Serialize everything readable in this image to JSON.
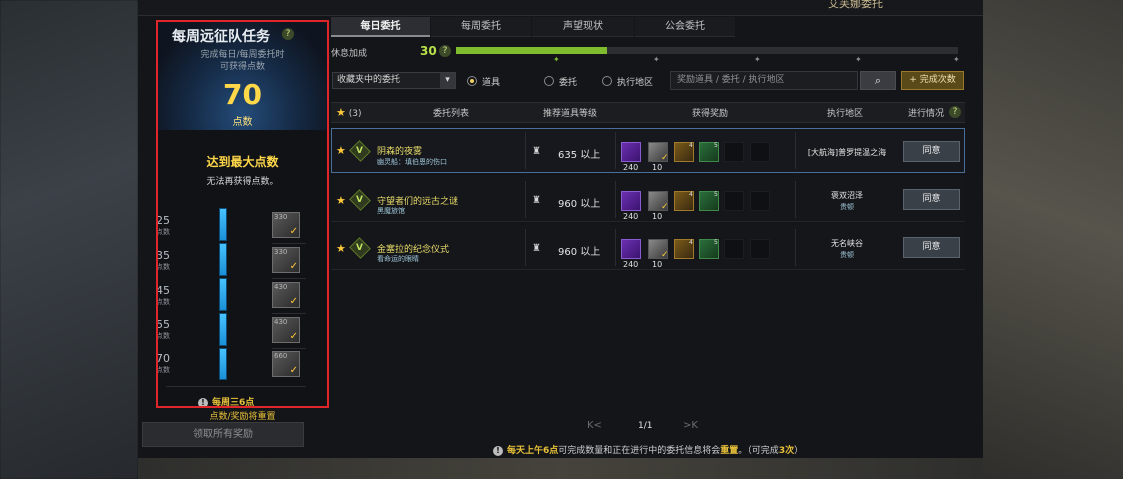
{
  "header_title": "艾芙娜委托",
  "weekly": {
    "title": "每周远征队任务",
    "help": "?",
    "subtitle_line1": "完成每日/每周委托时",
    "subtitle_line2": "可获得点数",
    "points": "70",
    "points_unit": "点数",
    "max_title": "达到最大点数",
    "max_sub": "无法再获得点数。",
    "tiers": [
      {
        "num": "25",
        "unit": "点数",
        "box": "330"
      },
      {
        "num": "35",
        "unit": "点数",
        "box": "330"
      },
      {
        "num": "45",
        "unit": "点数",
        "box": "430"
      },
      {
        "num": "55",
        "unit": "点数",
        "box": "430"
      },
      {
        "num": "70",
        "unit": "点数",
        "box": "660"
      }
    ],
    "reset_line1": "每周三6点",
    "reset_line2": "点数/奖励将重置",
    "claim_all": "领取所有奖励"
  },
  "tabs": [
    "每日委托",
    "每周委托",
    "声望现状",
    "公会委托"
  ],
  "rest": {
    "label": "休息加成",
    "value": "30",
    "help": "?",
    "progress": 0.3
  },
  "filters": {
    "select_value": "收藏夹中的委托",
    "options": [
      "道具",
      "委托",
      "执行地区"
    ],
    "selected_option": "道具",
    "search_placeholder": "奖励道具 / 委托 / 执行地区",
    "complete_btn": "完成次数"
  },
  "table": {
    "fav_count": "(3)",
    "headers": {
      "list": "委托列表",
      "level": "推荐道具等级",
      "reward": "获得奖励",
      "region": "执行地区",
      "progress": "进行情况",
      "help": "?"
    },
    "rows": [
      {
        "title": "阴森的夜雾",
        "sub": "幽灵船：填伯恩的伤口",
        "level": "635 以上",
        "purple": "240",
        "silver": "10",
        "gold": "4",
        "blue": "5",
        "region": "[大航海]普罗提温之海",
        "region_sub": "",
        "action": "同意"
      },
      {
        "title": "守望者们的远古之谜",
        "sub": "黑魔旅馆",
        "level": "960 以上",
        "purple": "240",
        "silver": "10",
        "gold": "4",
        "blue": "5",
        "region": "褒双沼泽",
        "region_sub": "贵顿",
        "action": "同意"
      },
      {
        "title": "金塞拉的纪念仪式",
        "sub": "看命运的眼睛",
        "level": "960 以上",
        "purple": "240",
        "silver": "10",
        "gold": "4",
        "blue": "5",
        "region": "无名峡谷",
        "region_sub": "贵顿",
        "action": "同意"
      }
    ]
  },
  "pager": {
    "prev": "K<",
    "page": "1/1",
    "next": ">K"
  },
  "footer": {
    "pre": "每天上午6点",
    "mid": "可完成数量和正在进行中的委托信息将会",
    "reset": "重置",
    "post": "。（可完成",
    "count": "3次",
    "end": "）"
  },
  "colors": {
    "accent_gold": "#ffd84a",
    "level_green": "#7fbd2e",
    "selection_border": "#4a6f9a",
    "frame_red": "#e0262b"
  }
}
